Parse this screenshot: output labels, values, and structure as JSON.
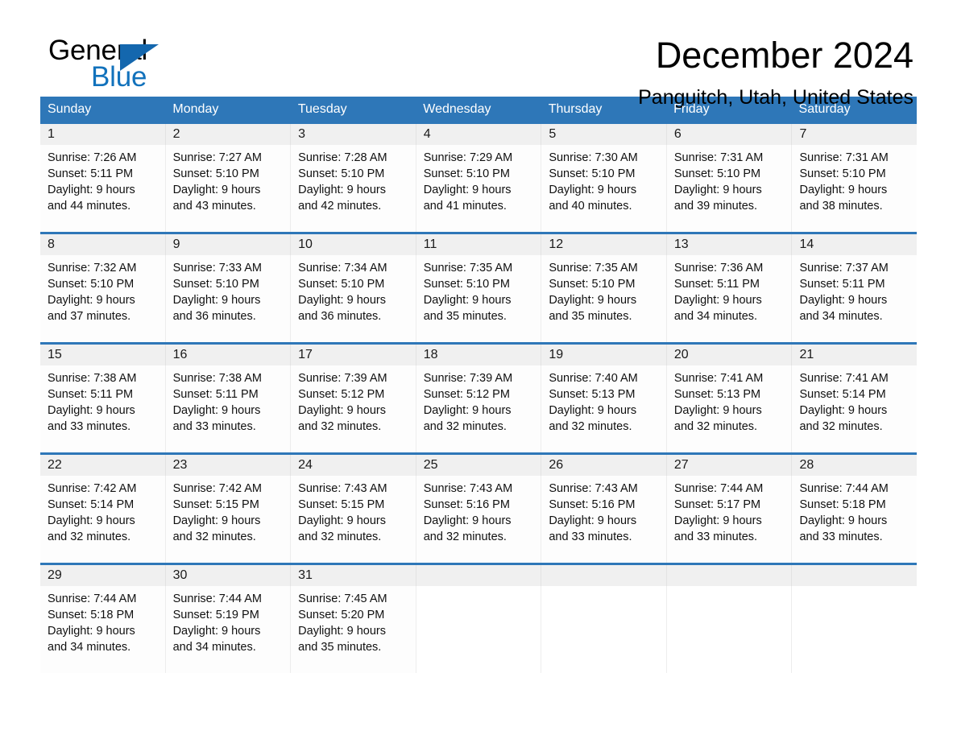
{
  "brand": {
    "line1": "General",
    "line2": "Blue",
    "triangle_color": "#1467ae",
    "blue_text_color": "#1272bc"
  },
  "header": {
    "title": "December 2024",
    "subtitle": "Panguitch, Utah, United States"
  },
  "colors": {
    "header_blue": "#2e77b8",
    "week_divider": "#2e77b8",
    "daynum_band": "#f0f0f0"
  },
  "weekdays": [
    "Sunday",
    "Monday",
    "Tuesday",
    "Wednesday",
    "Thursday",
    "Friday",
    "Saturday"
  ],
  "weeks": [
    {
      "days": [
        {
          "num": "1",
          "sunrise": "Sunrise: 7:26 AM",
          "sunset": "Sunset: 5:11 PM",
          "daylight1": "Daylight: 9 hours",
          "daylight2": "and 44 minutes."
        },
        {
          "num": "2",
          "sunrise": "Sunrise: 7:27 AM",
          "sunset": "Sunset: 5:10 PM",
          "daylight1": "Daylight: 9 hours",
          "daylight2": "and 43 minutes."
        },
        {
          "num": "3",
          "sunrise": "Sunrise: 7:28 AM",
          "sunset": "Sunset: 5:10 PM",
          "daylight1": "Daylight: 9 hours",
          "daylight2": "and 42 minutes."
        },
        {
          "num": "4",
          "sunrise": "Sunrise: 7:29 AM",
          "sunset": "Sunset: 5:10 PM",
          "daylight1": "Daylight: 9 hours",
          "daylight2": "and 41 minutes."
        },
        {
          "num": "5",
          "sunrise": "Sunrise: 7:30 AM",
          "sunset": "Sunset: 5:10 PM",
          "daylight1": "Daylight: 9 hours",
          "daylight2": "and 40 minutes."
        },
        {
          "num": "6",
          "sunrise": "Sunrise: 7:31 AM",
          "sunset": "Sunset: 5:10 PM",
          "daylight1": "Daylight: 9 hours",
          "daylight2": "and 39 minutes."
        },
        {
          "num": "7",
          "sunrise": "Sunrise: 7:31 AM",
          "sunset": "Sunset: 5:10 PM",
          "daylight1": "Daylight: 9 hours",
          "daylight2": "and 38 minutes."
        }
      ]
    },
    {
      "days": [
        {
          "num": "8",
          "sunrise": "Sunrise: 7:32 AM",
          "sunset": "Sunset: 5:10 PM",
          "daylight1": "Daylight: 9 hours",
          "daylight2": "and 37 minutes."
        },
        {
          "num": "9",
          "sunrise": "Sunrise: 7:33 AM",
          "sunset": "Sunset: 5:10 PM",
          "daylight1": "Daylight: 9 hours",
          "daylight2": "and 36 minutes."
        },
        {
          "num": "10",
          "sunrise": "Sunrise: 7:34 AM",
          "sunset": "Sunset: 5:10 PM",
          "daylight1": "Daylight: 9 hours",
          "daylight2": "and 36 minutes."
        },
        {
          "num": "11",
          "sunrise": "Sunrise: 7:35 AM",
          "sunset": "Sunset: 5:10 PM",
          "daylight1": "Daylight: 9 hours",
          "daylight2": "and 35 minutes."
        },
        {
          "num": "12",
          "sunrise": "Sunrise: 7:35 AM",
          "sunset": "Sunset: 5:10 PM",
          "daylight1": "Daylight: 9 hours",
          "daylight2": "and 35 minutes."
        },
        {
          "num": "13",
          "sunrise": "Sunrise: 7:36 AM",
          "sunset": "Sunset: 5:11 PM",
          "daylight1": "Daylight: 9 hours",
          "daylight2": "and 34 minutes."
        },
        {
          "num": "14",
          "sunrise": "Sunrise: 7:37 AM",
          "sunset": "Sunset: 5:11 PM",
          "daylight1": "Daylight: 9 hours",
          "daylight2": "and 34 minutes."
        }
      ]
    },
    {
      "days": [
        {
          "num": "15",
          "sunrise": "Sunrise: 7:38 AM",
          "sunset": "Sunset: 5:11 PM",
          "daylight1": "Daylight: 9 hours",
          "daylight2": "and 33 minutes."
        },
        {
          "num": "16",
          "sunrise": "Sunrise: 7:38 AM",
          "sunset": "Sunset: 5:11 PM",
          "daylight1": "Daylight: 9 hours",
          "daylight2": "and 33 minutes."
        },
        {
          "num": "17",
          "sunrise": "Sunrise: 7:39 AM",
          "sunset": "Sunset: 5:12 PM",
          "daylight1": "Daylight: 9 hours",
          "daylight2": "and 32 minutes."
        },
        {
          "num": "18",
          "sunrise": "Sunrise: 7:39 AM",
          "sunset": "Sunset: 5:12 PM",
          "daylight1": "Daylight: 9 hours",
          "daylight2": "and 32 minutes."
        },
        {
          "num": "19",
          "sunrise": "Sunrise: 7:40 AM",
          "sunset": "Sunset: 5:13 PM",
          "daylight1": "Daylight: 9 hours",
          "daylight2": "and 32 minutes."
        },
        {
          "num": "20",
          "sunrise": "Sunrise: 7:41 AM",
          "sunset": "Sunset: 5:13 PM",
          "daylight1": "Daylight: 9 hours",
          "daylight2": "and 32 minutes."
        },
        {
          "num": "21",
          "sunrise": "Sunrise: 7:41 AM",
          "sunset": "Sunset: 5:14 PM",
          "daylight1": "Daylight: 9 hours",
          "daylight2": "and 32 minutes."
        }
      ]
    },
    {
      "days": [
        {
          "num": "22",
          "sunrise": "Sunrise: 7:42 AM",
          "sunset": "Sunset: 5:14 PM",
          "daylight1": "Daylight: 9 hours",
          "daylight2": "and 32 minutes."
        },
        {
          "num": "23",
          "sunrise": "Sunrise: 7:42 AM",
          "sunset": "Sunset: 5:15 PM",
          "daylight1": "Daylight: 9 hours",
          "daylight2": "and 32 minutes."
        },
        {
          "num": "24",
          "sunrise": "Sunrise: 7:43 AM",
          "sunset": "Sunset: 5:15 PM",
          "daylight1": "Daylight: 9 hours",
          "daylight2": "and 32 minutes."
        },
        {
          "num": "25",
          "sunrise": "Sunrise: 7:43 AM",
          "sunset": "Sunset: 5:16 PM",
          "daylight1": "Daylight: 9 hours",
          "daylight2": "and 32 minutes."
        },
        {
          "num": "26",
          "sunrise": "Sunrise: 7:43 AM",
          "sunset": "Sunset: 5:16 PM",
          "daylight1": "Daylight: 9 hours",
          "daylight2": "and 33 minutes."
        },
        {
          "num": "27",
          "sunrise": "Sunrise: 7:44 AM",
          "sunset": "Sunset: 5:17 PM",
          "daylight1": "Daylight: 9 hours",
          "daylight2": "and 33 minutes."
        },
        {
          "num": "28",
          "sunrise": "Sunrise: 7:44 AM",
          "sunset": "Sunset: 5:18 PM",
          "daylight1": "Daylight: 9 hours",
          "daylight2": "and 33 minutes."
        }
      ]
    },
    {
      "days": [
        {
          "num": "29",
          "sunrise": "Sunrise: 7:44 AM",
          "sunset": "Sunset: 5:18 PM",
          "daylight1": "Daylight: 9 hours",
          "daylight2": "and 34 minutes."
        },
        {
          "num": "30",
          "sunrise": "Sunrise: 7:44 AM",
          "sunset": "Sunset: 5:19 PM",
          "daylight1": "Daylight: 9 hours",
          "daylight2": "and 34 minutes."
        },
        {
          "num": "31",
          "sunrise": "Sunrise: 7:45 AM",
          "sunset": "Sunset: 5:20 PM",
          "daylight1": "Daylight: 9 hours",
          "daylight2": "and 35 minutes."
        },
        {
          "num": "",
          "sunrise": "",
          "sunset": "",
          "daylight1": "",
          "daylight2": ""
        },
        {
          "num": "",
          "sunrise": "",
          "sunset": "",
          "daylight1": "",
          "daylight2": ""
        },
        {
          "num": "",
          "sunrise": "",
          "sunset": "",
          "daylight1": "",
          "daylight2": ""
        },
        {
          "num": "",
          "sunrise": "",
          "sunset": "",
          "daylight1": "",
          "daylight2": ""
        }
      ]
    }
  ]
}
